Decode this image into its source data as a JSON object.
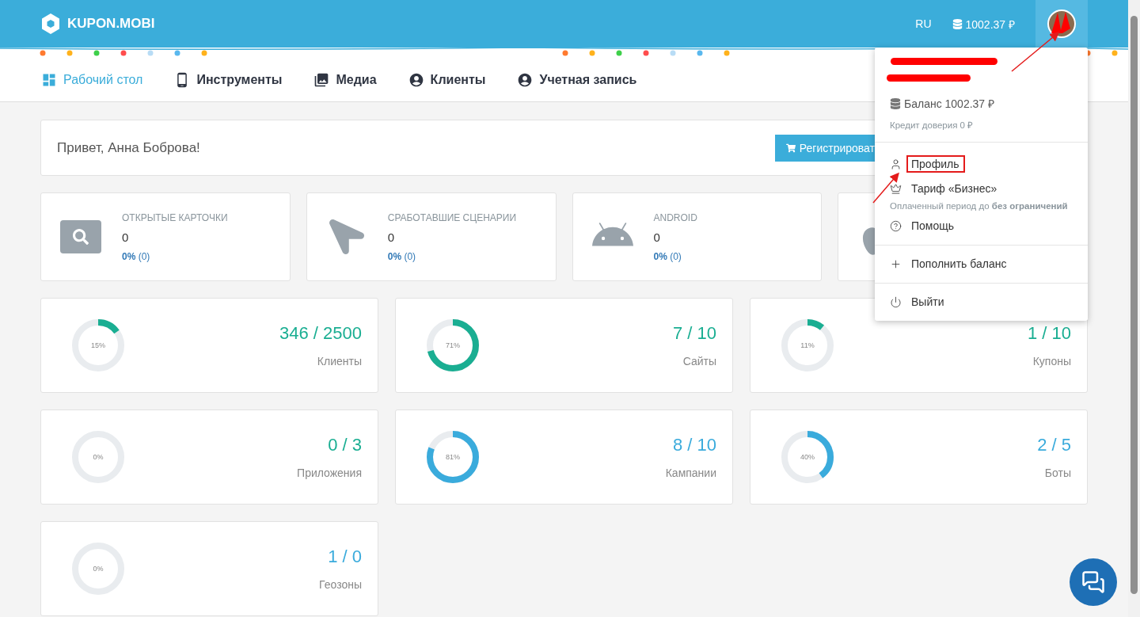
{
  "header": {
    "logo": "KUPON.MOBI",
    "language": "RU",
    "balance": "1002.37 ₽"
  },
  "nav": [
    {
      "label": "Рабочий стол",
      "selected": true
    },
    {
      "label": "Инструменты",
      "selected": false
    },
    {
      "label": "Медиа",
      "selected": false
    },
    {
      "label": "Клиенты",
      "selected": false
    },
    {
      "label": "Учетная запись",
      "selected": false
    }
  ],
  "greeting": {
    "text": "Привет, Анна Боброва!",
    "button": "Регистрироват"
  },
  "stats": [
    {
      "title": "ОТКРЫТЫЕ КАРТОЧКИ",
      "value": "0",
      "percent": "**0%** (0)"
    },
    {
      "title": "СРАБОТАВШИЕ СЦЕНАРИИ",
      "value": "0",
      "percent": "**0%** (0)"
    },
    {
      "title": "ANDROID",
      "value": "0",
      "percent": "**0%** (0)"
    }
  ],
  "counters": [
    {
      "percent": "15%",
      "level": 0.15,
      "value": "346 / 2500",
      "label": "Клиенты",
      "color": "#1aae92"
    },
    {
      "percent": "71%",
      "level": 0.71,
      "value": "7 / 10",
      "label": "Сайты",
      "color": "#1aae92"
    },
    {
      "percent": "11%",
      "level": 0.11,
      "value": "1 / 10",
      "label": "Купоны",
      "color": "#1aae92"
    },
    {
      "percent": "0%",
      "level": 0,
      "value": "0 / 3",
      "label": "Приложения",
      "color": "#1aae92"
    },
    {
      "percent": "81%",
      "level": 0.81,
      "value": "8 / 10",
      "label": "Кампании",
      "color": "#3aabdc"
    },
    {
      "percent": "40%",
      "level": 0.4,
      "value": "2 / 5",
      "label": "Боты",
      "color": "#3aabdc"
    },
    {
      "percent": "0%",
      "level": 0,
      "value": "1 / 0",
      "label": "Геозоны",
      "color": "#3aabdc"
    }
  ],
  "user_menu": {
    "balance": "Баланс 1002.37 ₽",
    "credit": "Кредит доверия 0 ₽",
    "items": [
      {
        "kind": "item",
        "label": "Профиль",
        "highlighted": true
      },
      {
        "kind": "item",
        "label": "Тариф «Бизнес»",
        "highlighted": false
      },
      {
        "kind": "note",
        "label": "Оплаченный период до **без ограничений**"
      },
      {
        "kind": "item",
        "label": "Помощь",
        "highlighted": false
      },
      {
        "kind": "divider"
      },
      {
        "kind": "item",
        "label": "Пополнить баланс",
        "highlighted": false
      },
      {
        "kind": "divider"
      },
      {
        "kind": "item",
        "label": "Выйти",
        "highlighted": false
      }
    ]
  }
}
